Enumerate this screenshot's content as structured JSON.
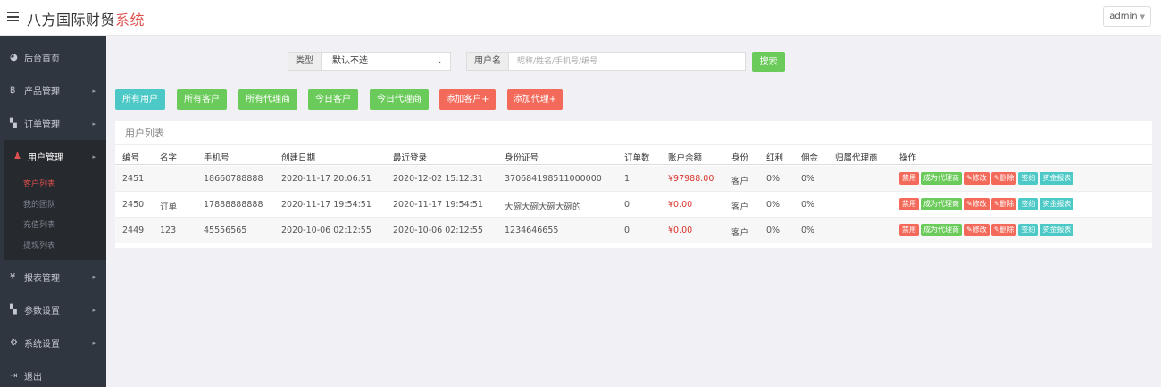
{
  "header": {
    "brand_main": "八方国际财贸",
    "brand_accent": "系统",
    "user": "admin"
  },
  "sidebar": {
    "items": [
      {
        "icon": "dashboard-icon",
        "glyph": "◕",
        "label": "后台首页",
        "arrow": ""
      },
      {
        "icon": "bitcoin-icon",
        "glyph": "฿",
        "label": "产品管理",
        "arrow": "▸"
      },
      {
        "icon": "copy-icon",
        "glyph": "▚",
        "label": "订单管理",
        "arrow": "▸"
      },
      {
        "icon": "user-icon",
        "glyph": "♟",
        "label": "用户管理",
        "arrow": "▸"
      }
    ],
    "sub_items": [
      "客户列表",
      "我的团队",
      "充值列表",
      "提现列表"
    ],
    "items_after": [
      {
        "icon": "yen-icon",
        "glyph": "¥",
        "label": "报表管理",
        "arrow": "▸"
      },
      {
        "icon": "copy-icon",
        "glyph": "▚",
        "label": "参数设置",
        "arrow": "▸"
      },
      {
        "icon": "cogs-icon",
        "glyph": "⚙",
        "label": "系统设置",
        "arrow": "▸"
      },
      {
        "icon": "sign-out-icon",
        "glyph": "⇥",
        "label": "退出",
        "arrow": ""
      }
    ]
  },
  "filters": {
    "type_label": "类型",
    "type_value": "默认不选",
    "user_label": "用户名",
    "user_placeholder": "昵称/姓名/手机号/编号",
    "search_label": "搜索"
  },
  "quick_buttons": [
    "所有用户",
    "所有客户",
    "所有代理商",
    "今日客户",
    "今日代理商",
    "添加客户+",
    "添加代理+"
  ],
  "table": {
    "title": "用户列表",
    "columns": [
      "编号",
      "名字",
      "手机号",
      "创建日期",
      "最近登录",
      "身份证号",
      "订单数",
      "账户余额",
      "身份",
      "红利",
      "佣金",
      "归属代理商",
      "操作"
    ],
    "rows": [
      [
        "2451",
        "",
        "18660788888",
        "2020-11-17 20:06:51",
        "2020-12-02 15:12:31",
        "370684198511000000",
        "1",
        "¥97988.00",
        "客户",
        "0%",
        "0%",
        ""
      ],
      [
        "2450",
        "订单",
        "17888888888",
        "2020-11-17 19:54:51",
        "2020-11-17 19:54:51",
        "大碗大碗大碗大碗的",
        "0",
        "¥0.00",
        "客户",
        "0%",
        "0%",
        ""
      ],
      [
        "2449",
        "123",
        "45556565",
        "2020-10-06 02:12:55",
        "2020-10-06 02:12:55",
        "1234646655",
        "0",
        "¥0.00",
        "客户",
        "0%",
        "0%",
        ""
      ]
    ],
    "actions": [
      "禁用",
      "成为代理商",
      "✎修改",
      "✎删除",
      "签约",
      "资金报表"
    ]
  },
  "colors": {
    "sidebar": "#2f3640",
    "accent": "#e0504d",
    "green": "#6bcb5a",
    "cyan": "#4cc9c6",
    "red": "#f36a5a",
    "money": "#d9342b"
  }
}
